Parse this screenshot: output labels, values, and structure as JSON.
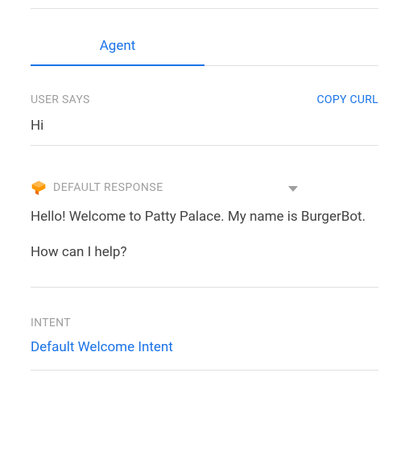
{
  "tabs": {
    "agent": "Agent"
  },
  "userSays": {
    "label": "USER SAYS",
    "copyCurl": "COPY CURL",
    "text": "Hi"
  },
  "response": {
    "dropdownLabel": "DEFAULT RESPONSE",
    "line1": "Hello! Welcome to Patty Palace. My name is BurgerBot.",
    "line2": "How can I help?"
  },
  "intent": {
    "label": "INTENT",
    "name": "Default Welcome Intent"
  }
}
